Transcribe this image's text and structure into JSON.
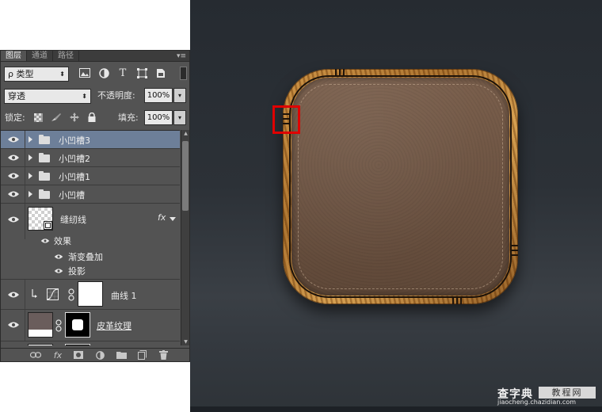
{
  "panel": {
    "tabs": [
      {
        "label": "图层",
        "active": true
      },
      {
        "label": "通道",
        "active": false
      },
      {
        "label": "路径",
        "active": false
      }
    ],
    "menu_glyph": "▾≡",
    "filter": {
      "label": "ρ 类型",
      "arrow": "⬍",
      "icons": [
        "image-filter-icon",
        "adjustment-filter-icon",
        "type-filter-icon",
        "shape-filter-icon",
        "smart-object-filter-icon"
      ],
      "type_icon_glyph": "T"
    },
    "blend": {
      "mode": "穿透",
      "arrow": "⬍",
      "opacity_label": "不透明度:",
      "opacity_value": "100%"
    },
    "lock": {
      "label": "锁定:",
      "fill_label": "填充:",
      "fill_value": "100%"
    },
    "dropdown_glyph": "▾",
    "layers": [
      {
        "name": "小凹槽3",
        "type": "group",
        "selected": true
      },
      {
        "name": "小凹槽2",
        "type": "group",
        "selected": false
      },
      {
        "name": "小凹槽1",
        "type": "group",
        "selected": false
      },
      {
        "name": "小凹槽",
        "type": "group",
        "selected": false
      },
      {
        "name": "缝纫线",
        "type": "layer",
        "fx": "fx",
        "effects_label": "效果",
        "effects": [
          "渐变叠加",
          "投影"
        ]
      },
      {
        "name": "曲线 1",
        "type": "adjustment"
      },
      {
        "name": "皮革纹理",
        "type": "layer-with-mask"
      }
    ],
    "scroll": {
      "up": "▲",
      "down": "▼"
    },
    "bottom_icons": [
      "link-layers-icon",
      "fx-icon",
      "add-mask-icon",
      "adjustment-layer-icon",
      "new-group-icon",
      "new-layer-icon",
      "delete-layer-icon"
    ],
    "bottom_fx_label": "fx"
  },
  "canvas": {
    "watermark": {
      "main": "查字典",
      "box": "教程网",
      "sub": "jiaocheng.chazidian.com"
    },
    "colors": {
      "background": "#2a2f35",
      "highlight": "#e00000",
      "selection": "#6d7f99"
    }
  }
}
